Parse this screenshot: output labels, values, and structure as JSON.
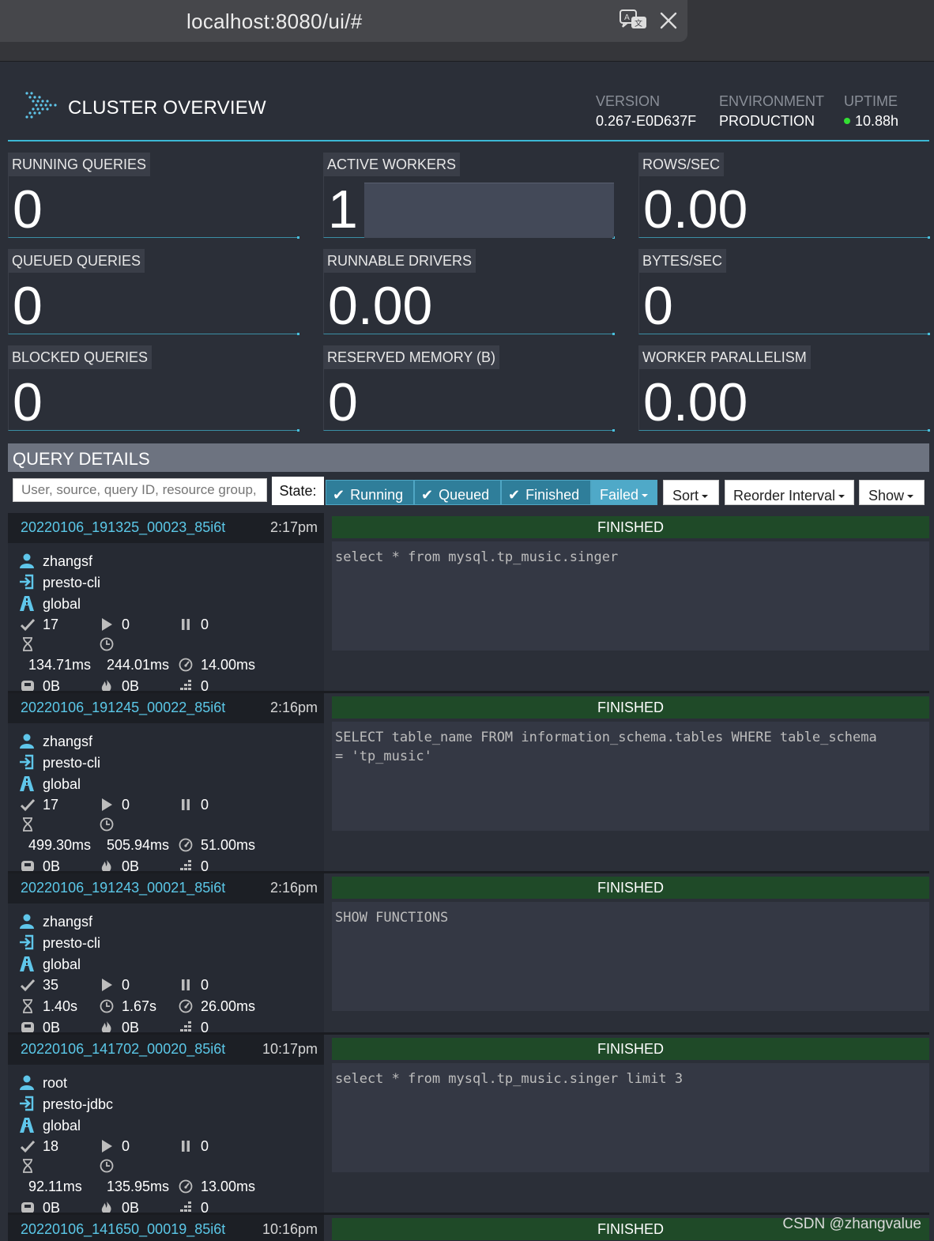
{
  "browser": {
    "url": "localhost:8080/ui/#"
  },
  "header": {
    "title": "CLUSTER OVERVIEW",
    "version_label": "VERSION",
    "version_value": "0.267-E0D637F",
    "environment_label": "ENVIRONMENT",
    "environment_value": "PRODUCTION",
    "uptime_label": "UPTIME",
    "uptime_value": "10.88h",
    "uptime_status_color": "#33e033"
  },
  "stats": {
    "running_queries": {
      "label": "RUNNING QUERIES",
      "value": "0"
    },
    "active_workers": {
      "label": "ACTIVE WORKERS",
      "value": "1"
    },
    "rows_sec": {
      "label": "ROWS/SEC",
      "value": "0.00"
    },
    "queued_queries": {
      "label": "QUEUED QUERIES",
      "value": "0"
    },
    "runnable_drivers": {
      "label": "RUNNABLE DRIVERS",
      "value": "0.00"
    },
    "bytes_sec": {
      "label": "BYTES/SEC",
      "value": "0"
    },
    "blocked_queries": {
      "label": "BLOCKED QUERIES",
      "value": "0"
    },
    "reserved_memory": {
      "label": "RESERVED MEMORY (B)",
      "value": "0"
    },
    "worker_parallelism": {
      "label": "WORKER PARALLELISM",
      "value": "0.00"
    }
  },
  "query_details": {
    "title": "QUERY DETAILS",
    "search_placeholder": "User, source, query ID, resource group, or query text",
    "state_label": "State:",
    "filters": {
      "running": "Running",
      "queued": "Queued",
      "finished": "Finished",
      "failed": "Failed"
    },
    "sort_label": "Sort",
    "reorder_label": "Reorder Interval",
    "show_label": "Show"
  },
  "queries": [
    {
      "id": "20220106_191325_00023_85i6t",
      "time": "2:17pm",
      "state": "FINISHED",
      "sql": "select * from mysql.tp_music.singer",
      "user": "zhangsf",
      "source": "presto-cli",
      "resource_group": "global",
      "completed_splits": "17",
      "running_splits": "0",
      "queued_splits": "0",
      "elapsed": "134.71ms",
      "cpu": "244.01ms",
      "execution": "14.00ms",
      "memory": "0B",
      "peak_memory": "0B",
      "input_rows": "0"
    },
    {
      "id": "20220106_191245_00022_85i6t",
      "time": "2:16pm",
      "state": "FINISHED",
      "sql": "SELECT table_name FROM information_schema.tables WHERE table_schema\n= 'tp_music'",
      "user": "zhangsf",
      "source": "presto-cli",
      "resource_group": "global",
      "completed_splits": "17",
      "running_splits": "0",
      "queued_splits": "0",
      "elapsed": "499.30ms",
      "cpu": "505.94ms",
      "execution": "51.00ms",
      "memory": "0B",
      "peak_memory": "0B",
      "input_rows": "0"
    },
    {
      "id": "20220106_191243_00021_85i6t",
      "time": "2:16pm",
      "state": "FINISHED",
      "sql": "SHOW FUNCTIONS",
      "user": "zhangsf",
      "source": "presto-cli",
      "resource_group": "global",
      "completed_splits": "35",
      "running_splits": "0",
      "queued_splits": "0",
      "elapsed": "1.40s",
      "cpu": "1.67s",
      "execution": "26.00ms",
      "memory": "0B",
      "peak_memory": "0B",
      "input_rows": "0"
    },
    {
      "id": "20220106_141702_00020_85i6t",
      "time": "10:17pm",
      "state": "FINISHED",
      "sql": "select * from mysql.tp_music.singer limit 3",
      "user": "root",
      "source": "presto-jdbc",
      "resource_group": "global",
      "completed_splits": "18",
      "running_splits": "0",
      "queued_splits": "0",
      "elapsed": "92.11ms",
      "cpu": "135.95ms",
      "execution": "13.00ms",
      "memory": "0B",
      "peak_memory": "0B",
      "input_rows": "0"
    },
    {
      "id": "20220106_141650_00019_85i6t",
      "time": "10:16pm",
      "state": "FINISHED"
    }
  ],
  "watermark": "CSDN @zhangvalue"
}
